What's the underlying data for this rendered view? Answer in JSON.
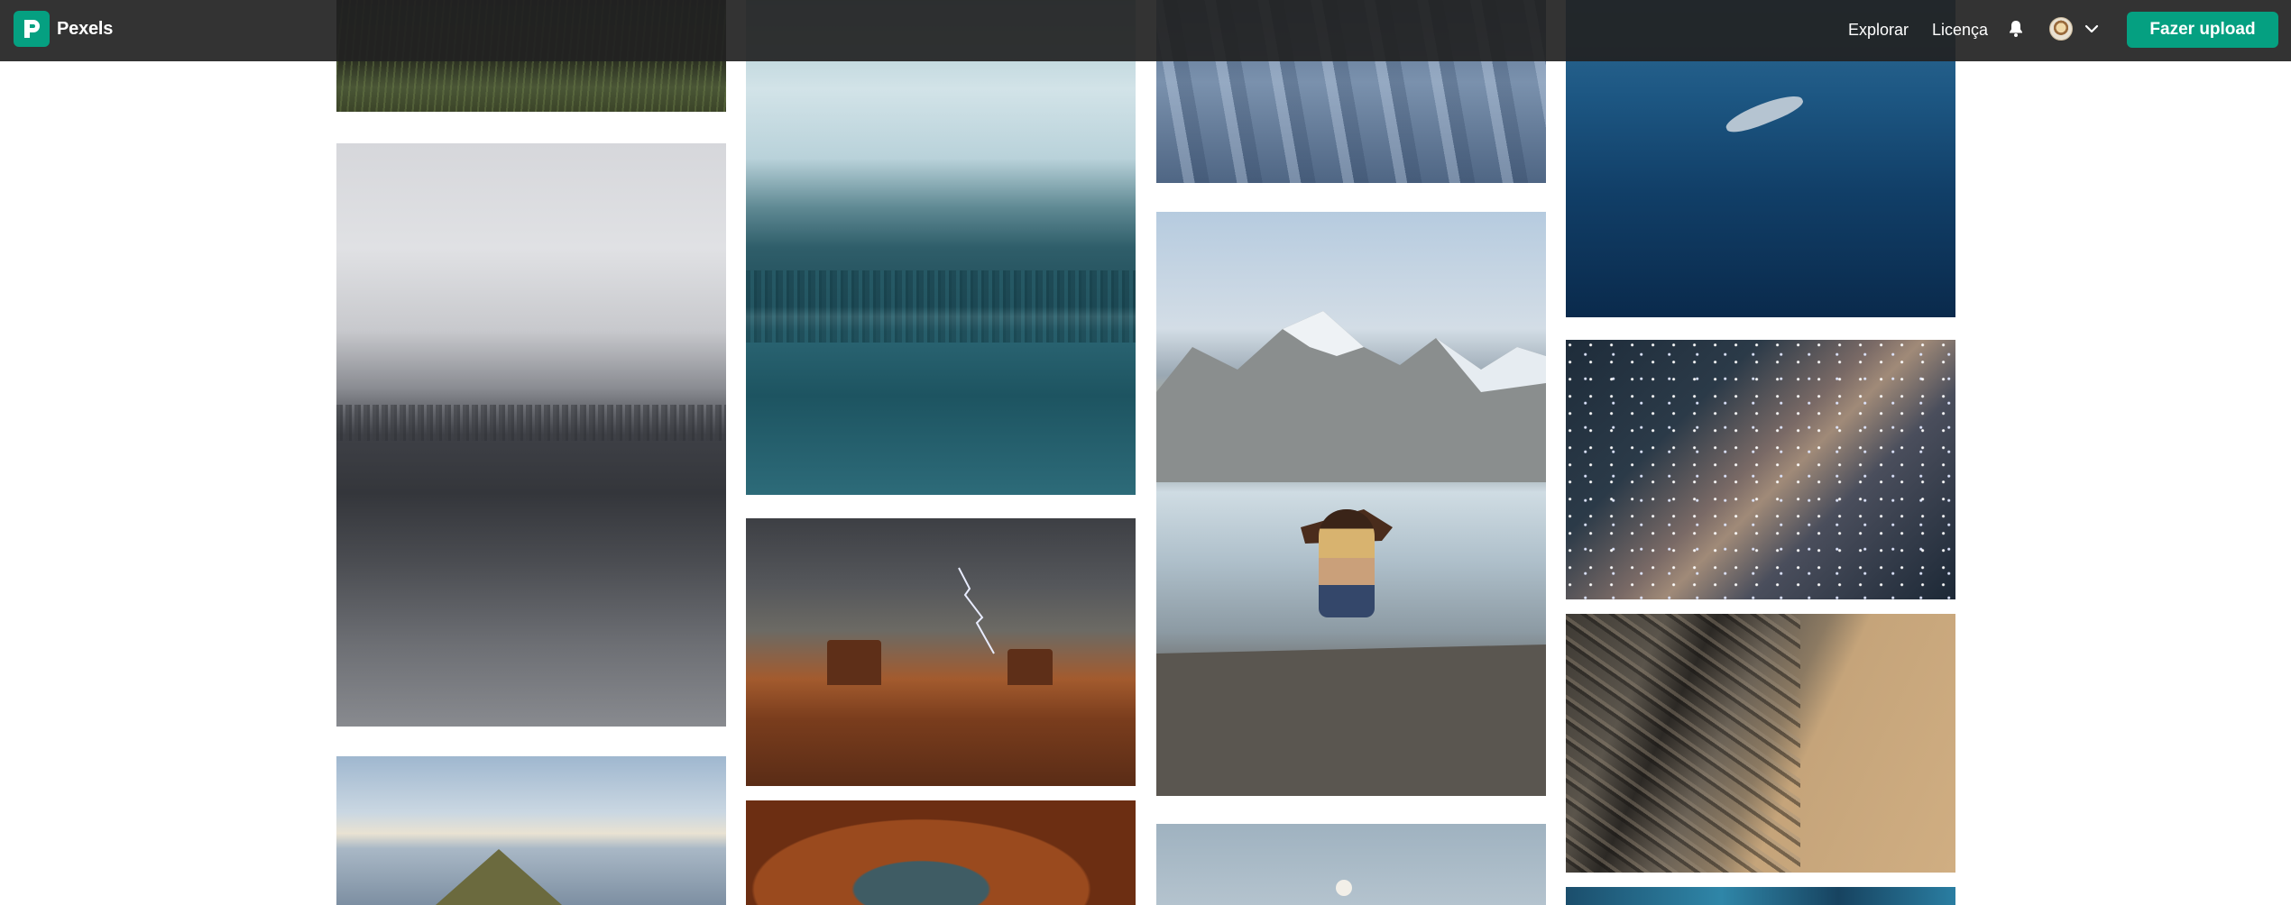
{
  "header": {
    "brand": "Pexels",
    "nav": {
      "explore": "Explorar",
      "license": "Licença"
    },
    "upload_label": "Fazer upload",
    "icons": {
      "logo": "pexels-logo-icon",
      "notifications": "bell-icon",
      "menu": "chevron-down-icon"
    }
  },
  "colors": {
    "brand": "#05a081",
    "header_bg": "#222222"
  },
  "gallery": {
    "columns": 4,
    "photos": [
      "forest-grass-photo",
      "foggy-forest-photo",
      "mountain-peak-photo",
      "misty-lake-photo",
      "desert-storm-photo",
      "bird-feathers-photo",
      "snow-ridges-photo",
      "lake-woman-photo",
      "moon-sky-photo",
      "shark-ocean-photo",
      "milky-way-photo",
      "canyon-aerial-photo",
      "blue-abstract-photo"
    ]
  }
}
